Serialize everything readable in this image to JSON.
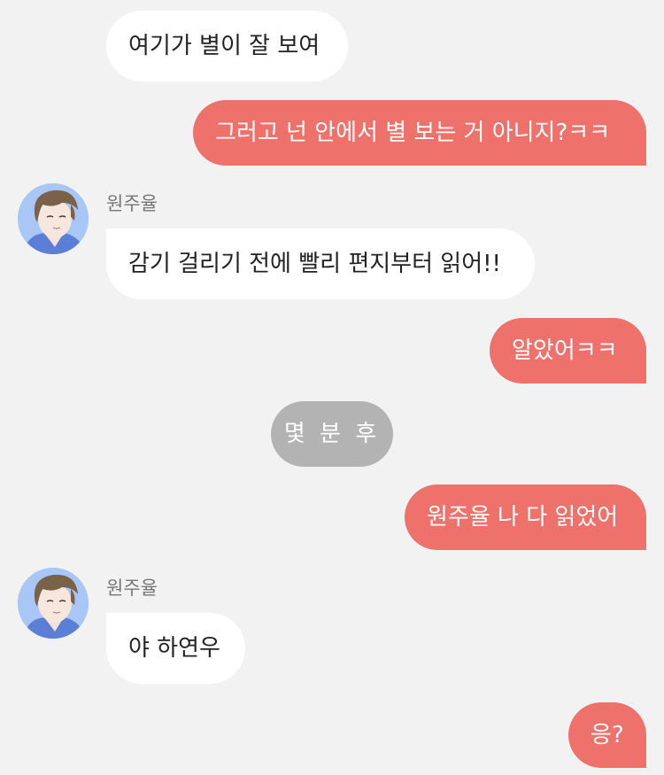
{
  "chat": {
    "messages": [
      {
        "text": "여기가 별이 잘 보여"
      },
      {
        "text": "그러고 넌 안에서 별 보는 거 아니지?ㅋㅋ"
      },
      {
        "sender": "원주율",
        "text": "감기 걸리기 전에 빨리 편지부터 읽어!!"
      },
      {
        "text": "알았어ㅋㅋ"
      },
      {
        "text": "원주율 나 다 읽었어"
      },
      {
        "sender": "원주율",
        "text": "야 하연우"
      },
      {
        "text": "응?"
      }
    ],
    "divider": "몇 분 후",
    "colors": {
      "background": "#f2f2f2",
      "incoming_bubble": "#ffffff",
      "outgoing_bubble": "#ef716c",
      "divider": "#b3b3b3"
    }
  }
}
